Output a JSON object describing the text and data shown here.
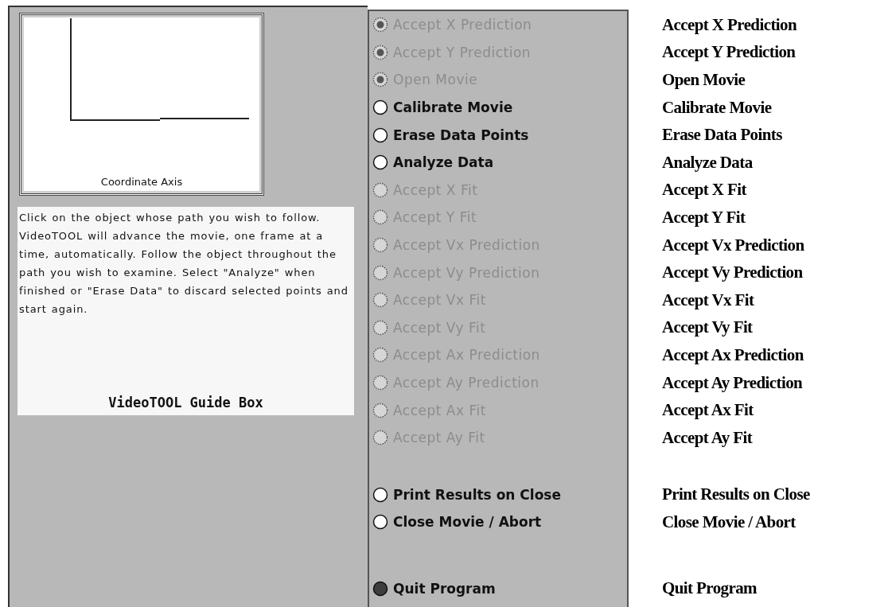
{
  "axis_panel": {
    "caption": "Coordinate Axis"
  },
  "guide_box": {
    "text": "Click on the object whose path you wish to follow.  VideoTOOL will advance the movie, one frame at a time, automatically.  Follow the object throughout the path you wish to examine. Select \"Analyze\" when finished or \"Erase Data\" to discard selected points and start again.",
    "title": "VideoTOOL Guide Box"
  },
  "option_groups": [
    [
      {
        "label": "Accept X Prediction",
        "selected": true,
        "disabled": true
      },
      {
        "label": "Accept Y Prediction",
        "selected": true,
        "disabled": true
      },
      {
        "label": "Open Movie",
        "selected": true,
        "disabled": true
      },
      {
        "label": "Calibrate Movie",
        "selected": false,
        "disabled": false
      },
      {
        "label": "Erase Data Points",
        "selected": false,
        "disabled": false
      },
      {
        "label": "Analyze Data",
        "selected": false,
        "disabled": false
      },
      {
        "label": "Accept X Fit",
        "selected": false,
        "disabled": true
      },
      {
        "label": "Accept Y Fit",
        "selected": false,
        "disabled": true
      },
      {
        "label": "Accept Vx Prediction",
        "selected": false,
        "disabled": true
      },
      {
        "label": "Accept Vy Prediction",
        "selected": false,
        "disabled": true
      },
      {
        "label": "Accept Vx Fit",
        "selected": false,
        "disabled": true
      },
      {
        "label": "Accept Vy Fit",
        "selected": false,
        "disabled": true
      },
      {
        "label": "Accept Ax Prediction",
        "selected": false,
        "disabled": true
      },
      {
        "label": "Accept Ay Prediction",
        "selected": false,
        "disabled": true
      },
      {
        "label": "Accept Ax Fit",
        "selected": false,
        "disabled": true
      },
      {
        "label": "Accept Ay Fit",
        "selected": false,
        "disabled": true
      }
    ],
    [
      {
        "label": "Print Results on Close",
        "selected": false,
        "disabled": false
      },
      {
        "label": "Close Movie / Abort",
        "selected": false,
        "disabled": false
      }
    ],
    [
      {
        "label": "Quit Program",
        "selected": true,
        "disabled": false
      }
    ]
  ],
  "caption_groups": [
    [
      "Accept X Prediction",
      "Accept Y Prediction",
      "Open Movie",
      "Calibrate Movie",
      "Erase Data Points",
      "Analyze Data",
      "Accept X Fit",
      "Accept Y Fit",
      "Accept Vx Prediction",
      "Accept Vy Prediction",
      "Accept Vx Fit",
      "Accept Vy Fit",
      "Accept Ax Prediction",
      "Accept Ay Prediction",
      "Accept Ax Fit",
      "Accept Ay Fit"
    ],
    [
      "Print Results on Close",
      "Close Movie / Abort"
    ],
    [
      "Quit Program"
    ]
  ]
}
